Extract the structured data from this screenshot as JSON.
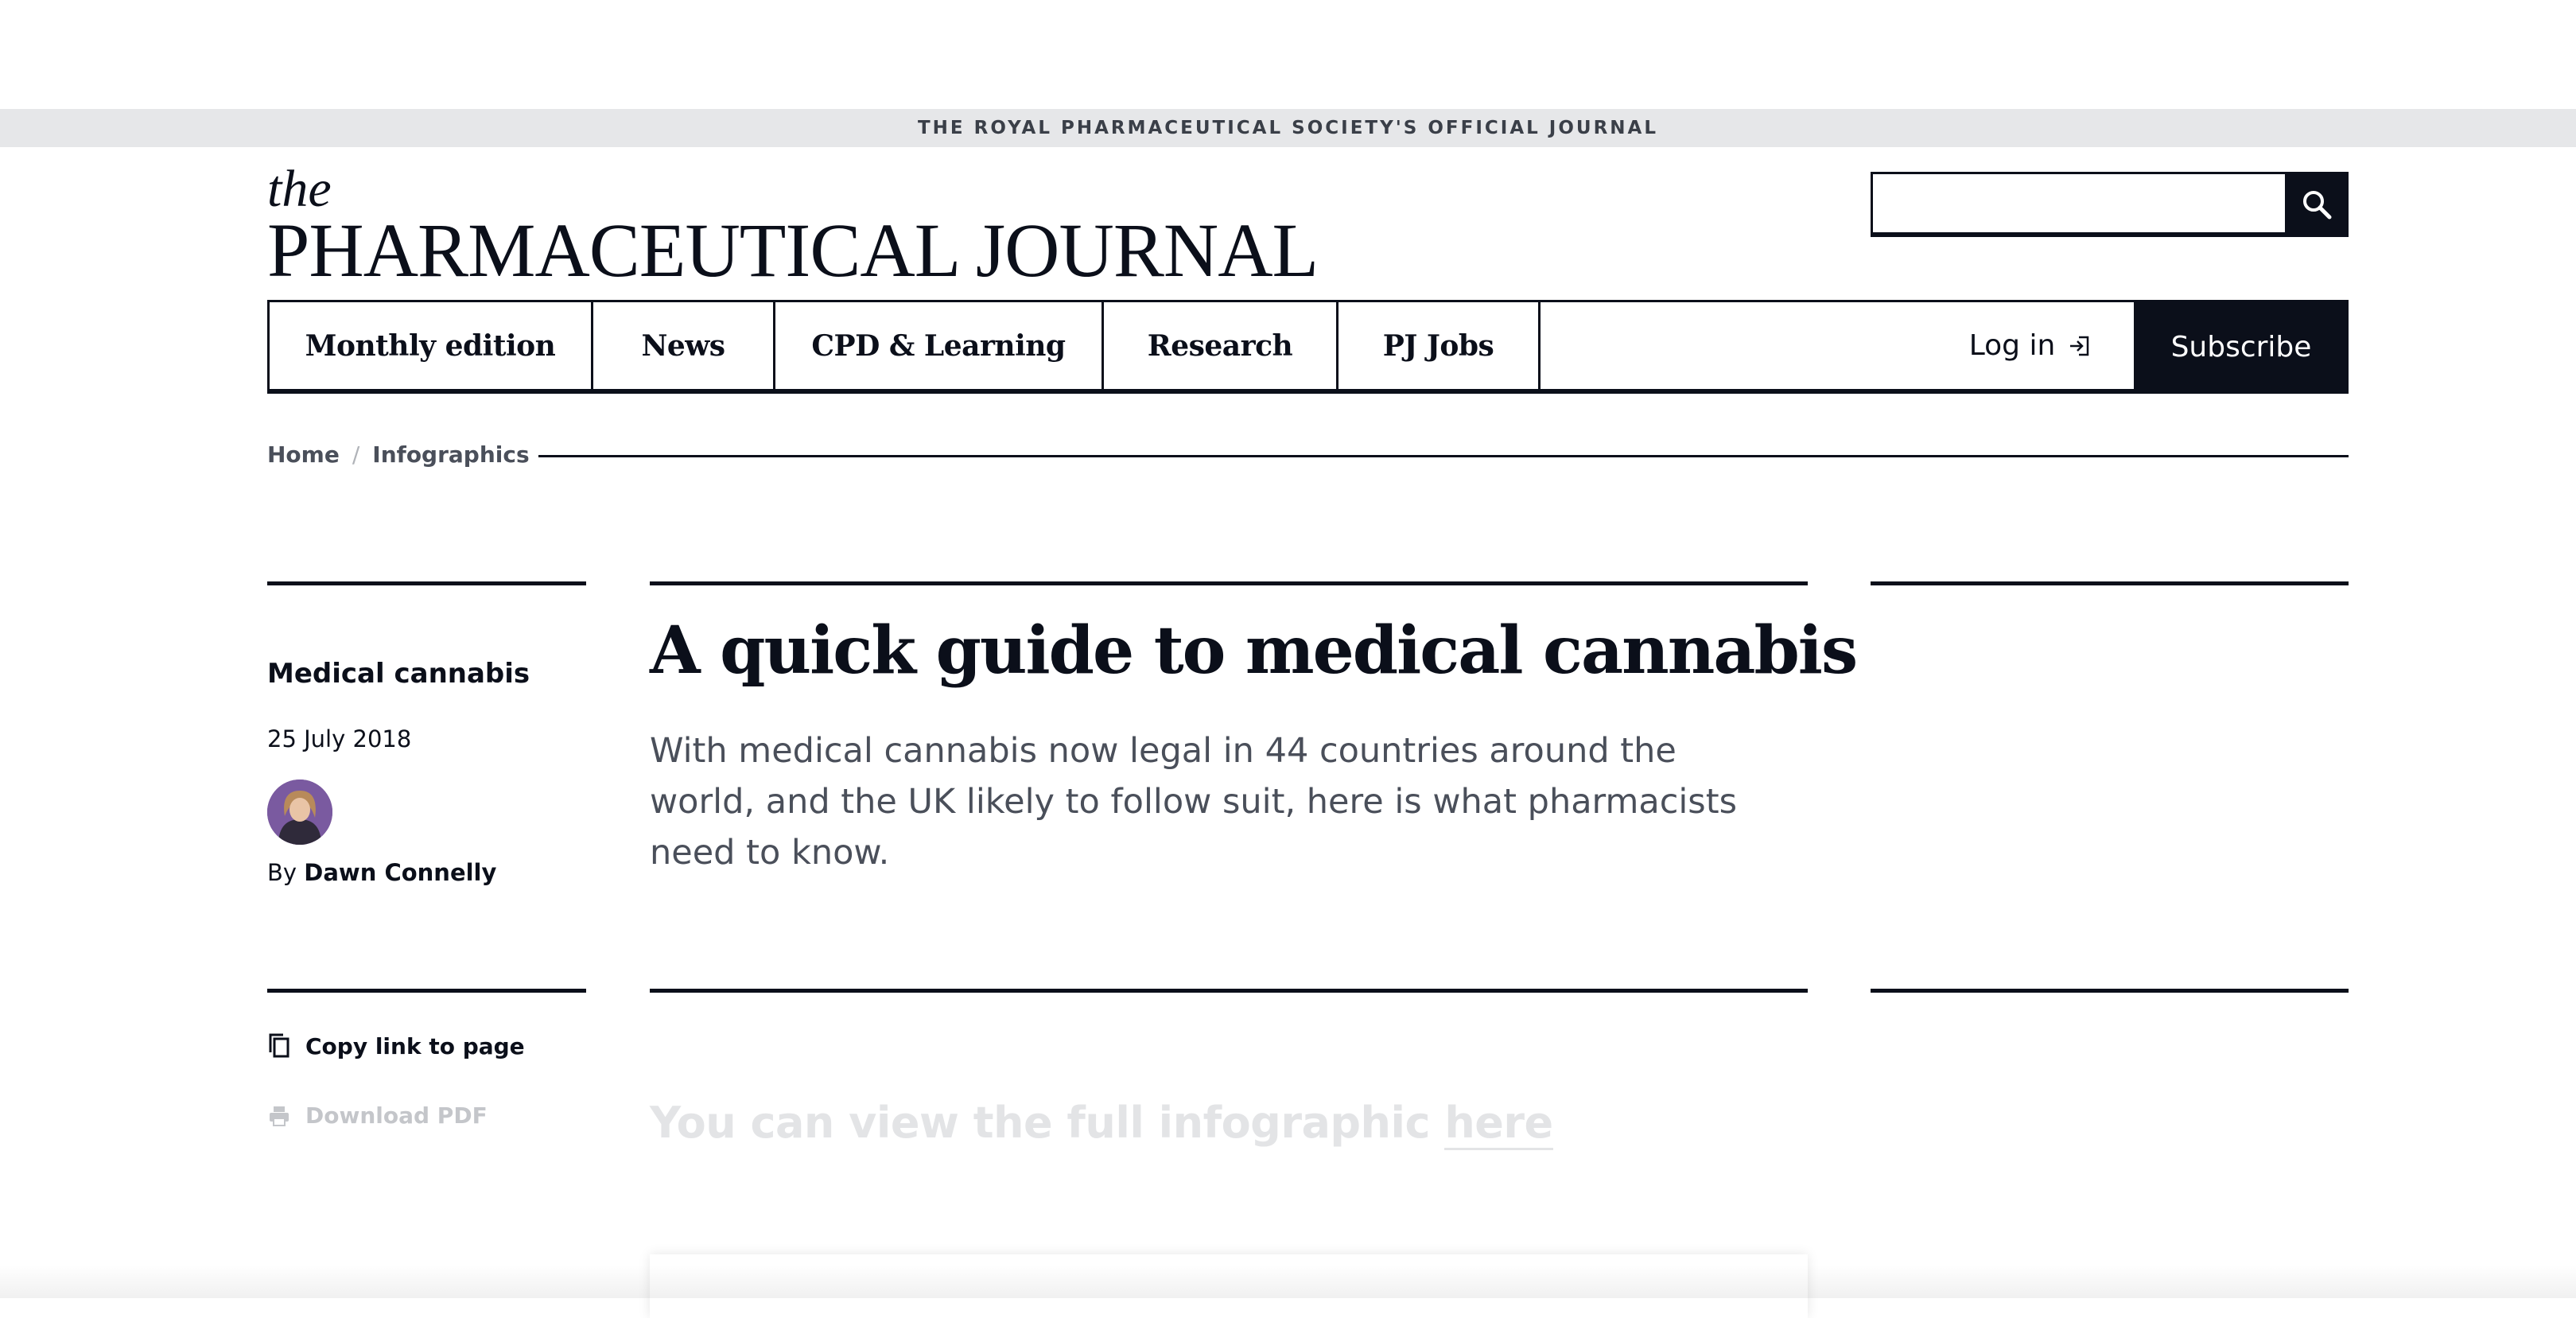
{
  "topbar": {
    "text": "THE ROYAL PHARMACEUTICAL SOCIETY'S OFFICIAL JOURNAL"
  },
  "logo": {
    "the": "the",
    "name": "PHARMACEUTICAL JOURNAL"
  },
  "search": {
    "placeholder": "",
    "icon": "search-icon"
  },
  "nav": {
    "items": [
      {
        "label": "Monthly edition"
      },
      {
        "label": "News"
      },
      {
        "label": "CPD & Learning"
      },
      {
        "label": "Research"
      },
      {
        "label": "PJ Jobs"
      }
    ],
    "login_label": "Log in",
    "login_icon": "login-icon",
    "subscribe_label": "Subscribe"
  },
  "breadcrumb": {
    "items": [
      {
        "label": "Home"
      },
      {
        "label": "Infographics"
      }
    ],
    "separator": "/"
  },
  "article": {
    "topic": "Medical cannabis",
    "date": "25 July 2018",
    "byline_prefix": "By",
    "author": "Dawn Connelly",
    "title": "A quick guide to medical cannabis",
    "standfirst": "With medical cannabis now legal in 44 countries around the world, and the UK likely to follow suit, here is what pharmacists need to know.",
    "faded_heading_prefix": "You can view the full infographic ",
    "faded_heading_link": "here"
  },
  "actions": {
    "copy_label": "Copy link to page",
    "copy_icon": "copy-icon",
    "pdf_label": "Download PDF",
    "pdf_icon": "print-icon"
  },
  "colors": {
    "ink": "#0b0f1a",
    "topbar_bg": "#e6e7e9",
    "muted_text": "#4a4f5a",
    "disabled": "#c4c6ca"
  }
}
